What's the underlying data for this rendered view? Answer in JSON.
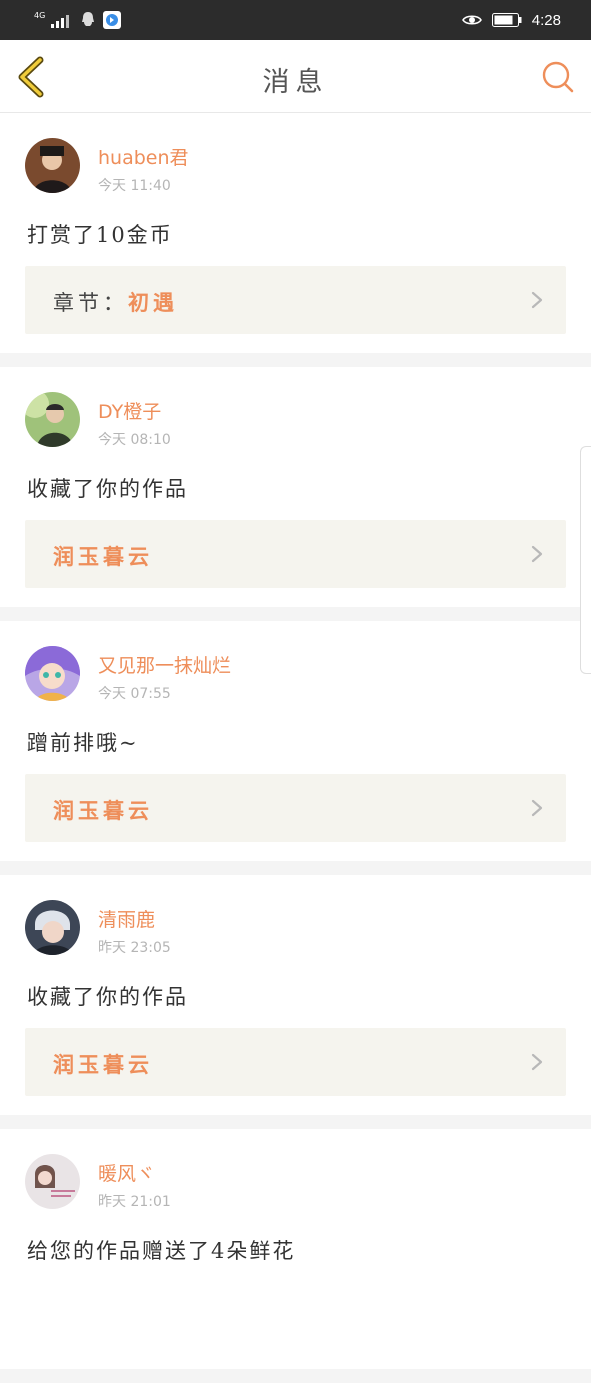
{
  "status_bar": {
    "network": "4G",
    "time": "4:28"
  },
  "navbar": {
    "title": "消息",
    "back_icon": "chevron-left-icon",
    "search_icon": "search-icon"
  },
  "colors": {
    "accent": "#ee8e5a",
    "back_icon": "#f0cc3a",
    "card_bg": "#f5f4ee"
  },
  "messages": [
    {
      "username": "huaben君",
      "time": "今天 11:40",
      "action": "打赏了10金币",
      "work_prefix": "章节：",
      "work_title": "初遇"
    },
    {
      "username": "DY橙子",
      "time": "今天 08:10",
      "action": "收藏了你的作品",
      "work_prefix": "",
      "work_title": "润玉暮云"
    },
    {
      "username": "又见那一抹灿烂",
      "time": "今天 07:55",
      "action": "蹭前排哦~",
      "work_prefix": "",
      "work_title": "润玉暮云"
    },
    {
      "username": "清雨鹿",
      "time": "昨天 23:05",
      "action": "收藏了你的作品",
      "work_prefix": "",
      "work_title": "润玉暮云"
    },
    {
      "username": "暖风ヾ",
      "time": "昨天 21:01",
      "action": "给您的作品赠送了4朵鲜花"
    }
  ]
}
